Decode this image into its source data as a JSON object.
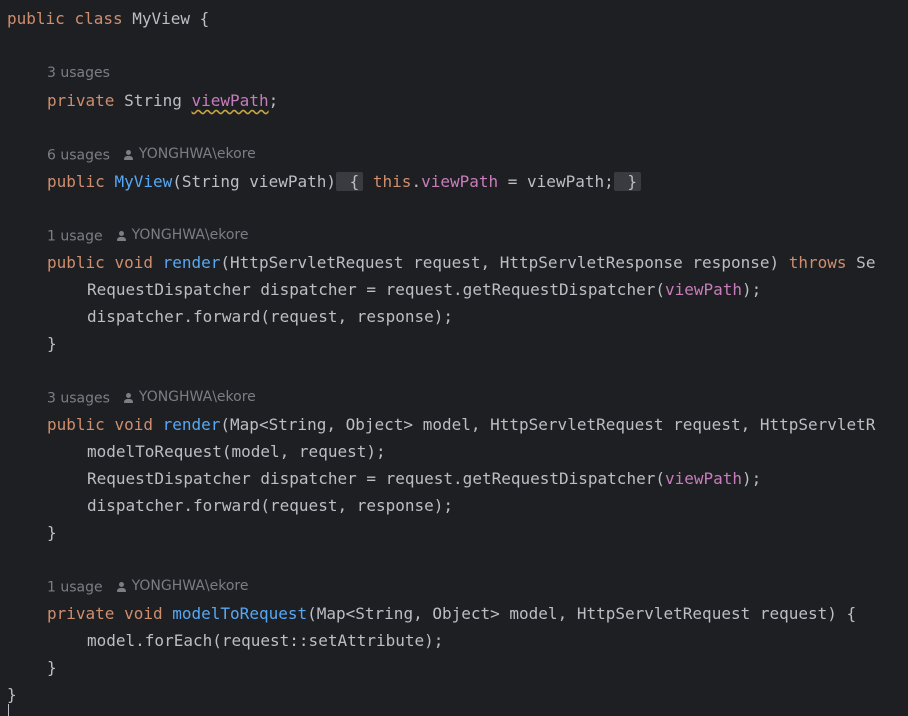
{
  "editor": {
    "author": "YONGHWA\\ekore",
    "class_decl": {
      "kw1": "public",
      "kw2": "class",
      "name": "MyView",
      "brace": " {"
    },
    "field_usages": "3 usages",
    "field_decl": {
      "kw": "private",
      "type": "String",
      "name": "viewPath",
      "semi": ";"
    },
    "ctor_usages": "6 usages",
    "ctor_decl": {
      "kw": "public",
      "name": "MyView",
      "params": "(String viewPath)",
      "open": " {",
      "this": "this",
      "dot": ".",
      "field": "viewPath",
      "assign": " = viewPath;",
      "close": " }"
    },
    "render1_usages": "1 usage",
    "render1": {
      "kw1": "public",
      "kw2": "void",
      "name": "render",
      "params": "(HttpServletRequest request, HttpServletResponse response) ",
      "throws": "throws",
      "tail": " Se",
      "line1_pre": "RequestDispatcher dispatcher = request.getRequestDispatcher(",
      "line1_field": "viewPath",
      "line1_post": ");",
      "line2": "dispatcher.forward(request, response);",
      "close": "}"
    },
    "render2_usages": "3 usages",
    "render2": {
      "kw1": "public",
      "kw2": "void",
      "name": "render",
      "params": "(Map<String, Object> model, HttpServletRequest request, HttpServletR",
      "line1": "modelToRequest(model, request);",
      "line2_pre": "RequestDispatcher dispatcher = request.getRequestDispatcher(",
      "line2_field": "viewPath",
      "line2_post": ");",
      "line3": "dispatcher.forward(request, response);",
      "close": "}"
    },
    "m2r_usages": "1 usage",
    "m2r": {
      "kw1": "private",
      "kw2": "void",
      "name": "modelToRequest",
      "params": "(Map<String, Object> model, HttpServletRequest request) {",
      "line1": "model.forEach(request::setAttribute);",
      "close": "}"
    },
    "class_close": "}"
  }
}
